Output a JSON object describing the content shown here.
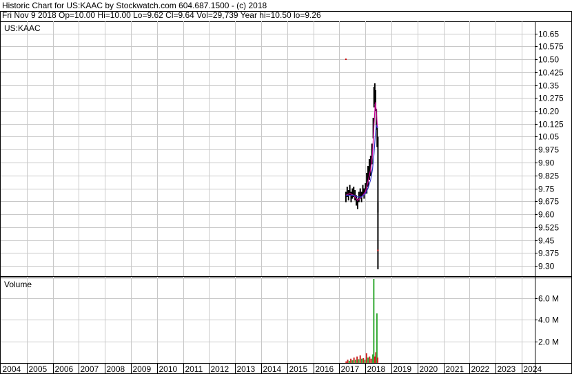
{
  "header": {
    "line1": "Historic Chart for US:KAAC by Stockwatch.com 604.687.1500 - (c) 2018",
    "line2": "Fri Nov  9 2018   Op=10.00   Hi=10.00   Lo=9.62   Cl=9.64   Vol=29,739   Year hi=10.50   lo=9.26"
  },
  "chart_data": [
    {
      "type": "line",
      "title": "US:KAAC",
      "y_ticks": [
        "10.65",
        "10.575",
        "10.50",
        "10.425",
        "10.35",
        "10.275",
        "10.20",
        "10.125",
        "10.05",
        "9.975",
        "9.90",
        "9.825",
        "9.75",
        "9.675",
        "9.60",
        "9.525",
        "9.45",
        "9.375",
        "9.30"
      ],
      "ylim": [
        9.24,
        10.72
      ],
      "x_ticks": [
        "2004",
        "2005",
        "2006",
        "2007",
        "2008",
        "2009",
        "2010",
        "2011",
        "2012",
        "2013",
        "2014",
        "2015",
        "2016",
        "2017",
        "2018",
        "2019",
        "2020",
        "2021",
        "2022",
        "2023",
        "2024"
      ],
      "xlim": [
        2004.0,
        2024.5
      ],
      "grid": true,
      "series": [
        {
          "color": "#000000",
          "style": "price-bars",
          "points": [
            [
              2017.25,
              9.7
            ],
            [
              2017.3,
              9.73
            ],
            [
              2017.35,
              9.71
            ],
            [
              2017.4,
              9.74
            ],
            [
              2017.45,
              9.7
            ],
            [
              2017.5,
              9.72
            ],
            [
              2017.55,
              9.73
            ],
            [
              2017.6,
              9.71
            ],
            [
              2017.65,
              9.68
            ],
            [
              2017.7,
              9.66
            ],
            [
              2017.75,
              9.7
            ],
            [
              2017.8,
              9.72
            ],
            [
              2017.85,
              9.7
            ],
            [
              2017.9,
              9.74
            ],
            [
              2017.95,
              9.72
            ],
            [
              2018.0,
              9.75
            ],
            [
              2018.05,
              9.78
            ],
            [
              2018.1,
              9.82
            ],
            [
              2018.15,
              9.86
            ],
            [
              2018.2,
              9.88
            ],
            [
              2018.25,
              9.95
            ],
            [
              2018.3,
              10.1
            ],
            [
              2018.33,
              10.28
            ],
            [
              2018.36,
              10.3
            ],
            [
              2018.39,
              10.26
            ],
            [
              2018.42,
              10.15
            ],
            [
              2018.45,
              10.05
            ],
            [
              2018.48,
              9.64
            ]
          ]
        },
        {
          "color": "#cc0099",
          "style": "line",
          "points": [
            [
              2017.25,
              9.71
            ],
            [
              2017.4,
              9.72
            ],
            [
              2017.55,
              9.71
            ],
            [
              2017.7,
              9.68
            ],
            [
              2017.85,
              9.7
            ],
            [
              2018.0,
              9.73
            ],
            [
              2018.1,
              9.79
            ],
            [
              2018.2,
              9.86
            ],
            [
              2018.27,
              9.95
            ],
            [
              2018.33,
              10.12
            ],
            [
              2018.38,
              10.25
            ],
            [
              2018.42,
              10.2
            ],
            [
              2018.46,
              10.1
            ]
          ]
        },
        {
          "color": "#3333cc",
          "style": "line",
          "points": [
            [
              2017.25,
              9.71
            ],
            [
              2017.4,
              9.71
            ],
            [
              2017.55,
              9.71
            ],
            [
              2017.7,
              9.7
            ],
            [
              2017.85,
              9.7
            ],
            [
              2018.0,
              9.72
            ],
            [
              2018.1,
              9.75
            ],
            [
              2018.2,
              9.8
            ],
            [
              2018.27,
              9.86
            ],
            [
              2018.33,
              9.95
            ],
            [
              2018.38,
              10.06
            ],
            [
              2018.42,
              10.12
            ],
            [
              2018.46,
              10.1
            ]
          ]
        }
      ],
      "outliers": [
        [
          2017.25,
          10.5
        ],
        [
          2018.48,
          9.39
        ]
      ]
    },
    {
      "type": "bar",
      "title": "Volume",
      "y_ticks": [
        "6.0 M",
        "4.0 M",
        "2.0 M"
      ],
      "ylim": [
        0,
        7.8
      ],
      "unit": "M",
      "bars": [
        [
          2017.26,
          0.15,
          "red"
        ],
        [
          2017.32,
          0.3,
          "red"
        ],
        [
          2017.38,
          0.2,
          "green"
        ],
        [
          2017.44,
          0.4,
          "red"
        ],
        [
          2017.5,
          0.25,
          "green"
        ],
        [
          2017.56,
          0.5,
          "red"
        ],
        [
          2017.62,
          0.3,
          "green"
        ],
        [
          2017.68,
          0.6,
          "red"
        ],
        [
          2017.74,
          0.35,
          "green"
        ],
        [
          2017.8,
          0.7,
          "red"
        ],
        [
          2017.86,
          0.4,
          "green"
        ],
        [
          2017.92,
          0.45,
          "red"
        ],
        [
          2017.98,
          0.3,
          "green"
        ],
        [
          2018.04,
          0.9,
          "red"
        ],
        [
          2018.1,
          0.5,
          "green"
        ],
        [
          2018.16,
          0.6,
          "red"
        ],
        [
          2018.22,
          0.4,
          "red"
        ],
        [
          2018.28,
          0.8,
          "green"
        ],
        [
          2018.32,
          7.8,
          "green"
        ],
        [
          2018.36,
          0.6,
          "red"
        ],
        [
          2018.4,
          1.0,
          "red"
        ],
        [
          2018.44,
          4.6,
          "green"
        ],
        [
          2018.47,
          0.5,
          "red"
        ]
      ]
    }
  ]
}
